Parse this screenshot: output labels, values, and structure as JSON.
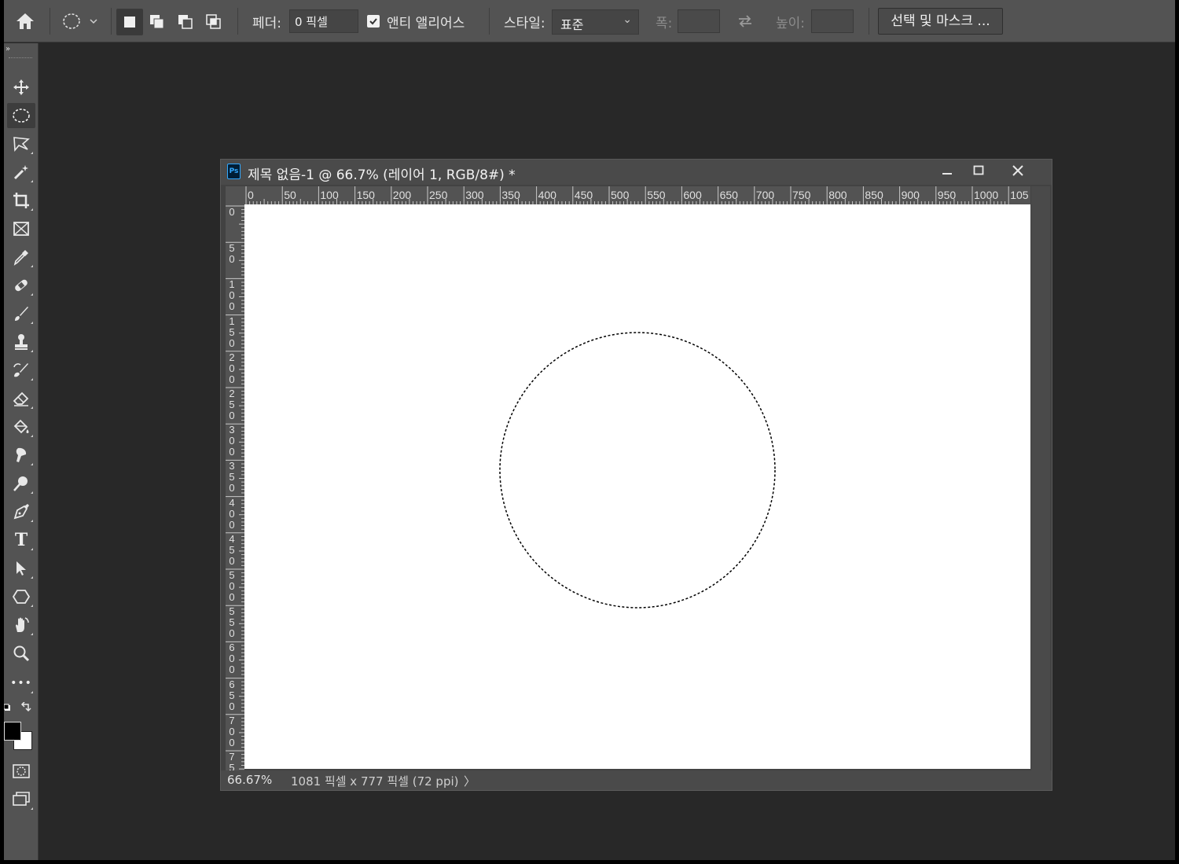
{
  "options_bar": {
    "feather_label": "페더:",
    "feather_value": "0 픽셀",
    "antialias_label": "앤티 앨리어스",
    "antialias_checked": true,
    "style_label": "스타일:",
    "style_value": "표준",
    "width_label": "폭:",
    "height_label": "높이:",
    "select_mask_label": "선택 및 마스크 ..."
  },
  "document": {
    "title": "제목 없음-1 @ 66.7% (레이어 1, RGB/8#) *",
    "ps_badge": "Ps",
    "hruler_ticks": [
      "0",
      "50",
      "100",
      "150",
      "200",
      "250",
      "300",
      "350",
      "400",
      "450",
      "500",
      "550",
      "600",
      "650",
      "700",
      "750",
      "800",
      "850",
      "900",
      "950",
      "1000",
      "105"
    ],
    "vruler_ticks": [
      "0",
      "50",
      "100",
      "150",
      "200",
      "250",
      "300",
      "350",
      "400",
      "450",
      "500",
      "550",
      "600",
      "650",
      "700",
      "75"
    ]
  },
  "statusbar": {
    "zoom": "66.67%",
    "info": "1081 픽셀 x 777 픽셀 (72 ppi)",
    "arrow": "〉"
  },
  "tools": [
    "move-tool",
    "elliptical-marquee-tool",
    "lasso-tool",
    "magic-wand-tool",
    "crop-tool",
    "frame-tool",
    "eyedropper-tool",
    "healing-brush-tool",
    "brush-tool",
    "clone-stamp-tool",
    "history-brush-tool",
    "eraser-tool",
    "paint-bucket-tool",
    "smudge-tool",
    "dodge-tool",
    "pen-tool",
    "type-tool",
    "path-selection-tool",
    "polygon-tool",
    "hand-tool",
    "zoom-tool",
    "more-tools"
  ],
  "type_tool_glyph": "T",
  "more_tools_glyph": "•••",
  "colors": {
    "foreground": "#000000",
    "background": "#ffffff",
    "ui_panel": "#535353",
    "workspace": "#282828"
  }
}
